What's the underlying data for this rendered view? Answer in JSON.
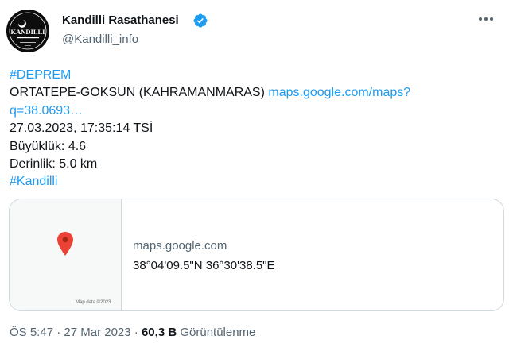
{
  "author": {
    "display_name": "Kandilli Rasathanesi",
    "handle": "@Kandilli_info",
    "verified": true,
    "avatar_text": "KANDILLI",
    "avatar_icon": "kandilli-logo-icon"
  },
  "tweet": {
    "hashtag_deprem": "#DEPREM",
    "location": "ORTATEPE-GOKSUN (KAHRAMANMARAS)",
    "link_part1": "maps.google.com/maps?",
    "link_part2": "q=38.0693…",
    "datetime": "27.03.2023, 17:35:14 TSİ",
    "magnitude": "Büyüklük: 4.6",
    "depth": "Derinlik: 5.0 km",
    "hashtag_kandilli": "#Kandilli"
  },
  "card": {
    "domain": "maps.google.com",
    "coordinates": "38°04'09.5\"N 36°30'38.5\"E",
    "map_credit": "Map data ©2023",
    "pin_icon": "map-pin-icon"
  },
  "meta": {
    "time": "ÖS 5:47",
    "separator": "·",
    "date": "27 Mar 2023",
    "views_count": "60,3 B",
    "views_label": "Görüntülenme"
  },
  "colors": {
    "link": "#1d9bf0",
    "secondary_text": "#536471",
    "verified_badge": "#1d9bf0",
    "pin": "#ea4335",
    "border": "#cfd9de"
  }
}
